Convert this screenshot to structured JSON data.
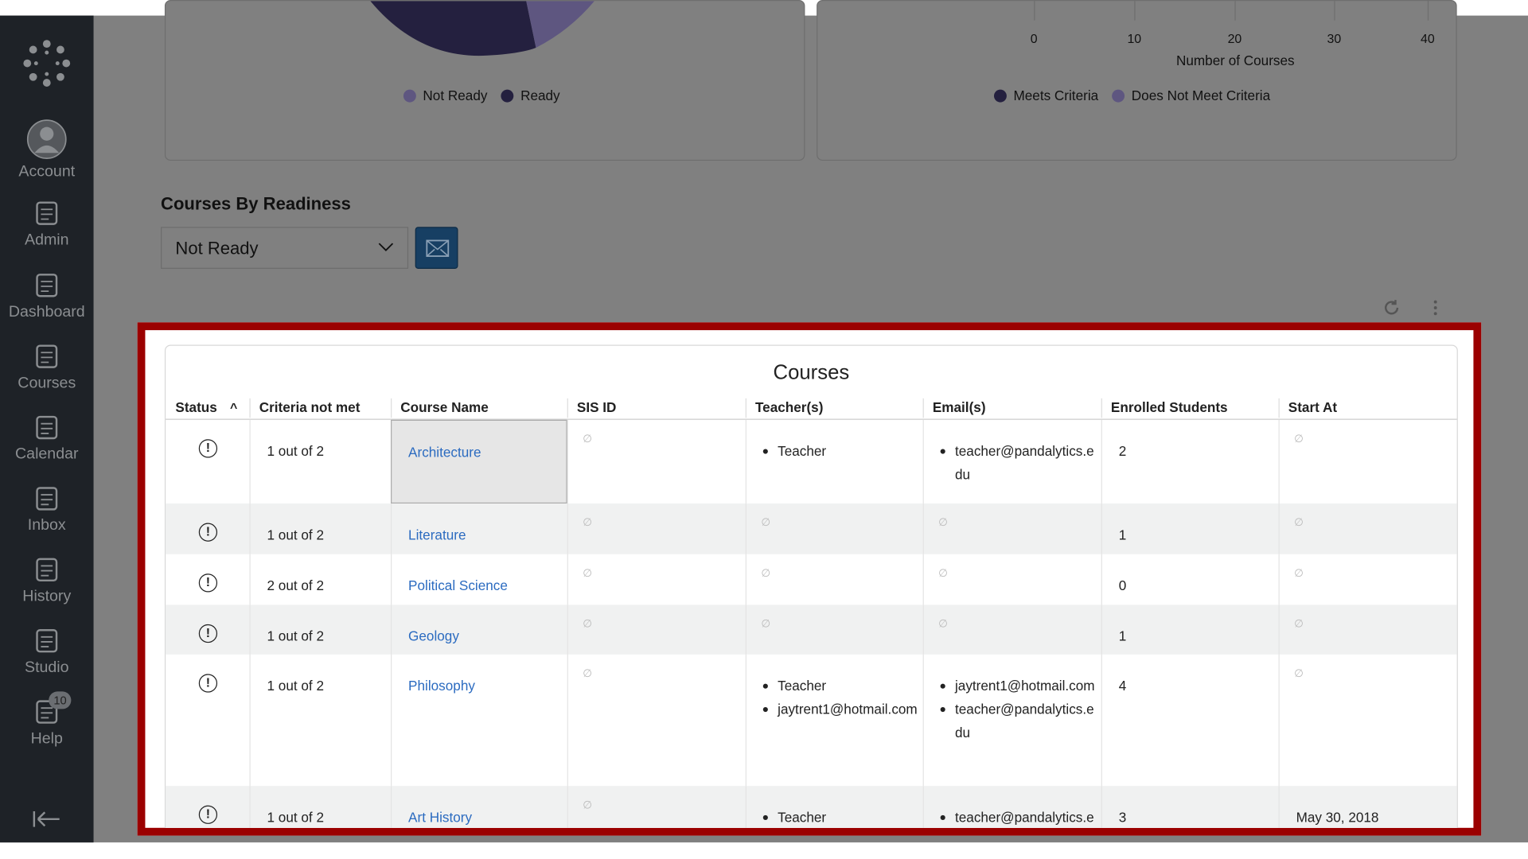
{
  "sidebar": {
    "items": [
      {
        "label": "Account",
        "icon": "account-icon"
      },
      {
        "label": "Admin",
        "icon": "admin-shield-icon"
      },
      {
        "label": "Dashboard",
        "icon": "dashboard-gauge-icon"
      },
      {
        "label": "Courses",
        "icon": "courses-book-icon"
      },
      {
        "label": "Calendar",
        "icon": "calendar-icon"
      },
      {
        "label": "Inbox",
        "icon": "inbox-icon"
      },
      {
        "label": "History",
        "icon": "clock-icon"
      },
      {
        "label": "Studio",
        "icon": "studio-icon"
      },
      {
        "label": "Help",
        "icon": "help-icon",
        "badge": "10"
      }
    ]
  },
  "pie_card": {
    "legend": [
      {
        "label": "Not Ready",
        "color": "#5e5680"
      },
      {
        "label": "Ready",
        "color": "#24203f"
      }
    ]
  },
  "bar_card": {
    "ticks": [
      "0",
      "10",
      "20",
      "30",
      "40"
    ],
    "xlabel": "Number of Courses",
    "legend": [
      {
        "label": "Meets Criteria",
        "color": "#24203f"
      },
      {
        "label": "Does Not Meet Criteria",
        "color": "#5e5680"
      }
    ]
  },
  "readiness": {
    "title": "Courses By Readiness",
    "selected": "Not Ready"
  },
  "table": {
    "title": "Courses",
    "columns": [
      "Status",
      "Criteria not met",
      "Course Name",
      "SIS ID",
      "Teacher(s)",
      "Email(s)",
      "Enrolled Students",
      "Start At"
    ],
    "null_symbol": "∅",
    "rows": [
      {
        "criteria": "1 out of 2",
        "course": "Architecture",
        "sis": null,
        "teachers": [
          "Teacher"
        ],
        "emails": [
          "teacher@pandalytics.edu"
        ],
        "enrolled": "2",
        "start": null
      },
      {
        "criteria": "1 out of 2",
        "course": "Literature",
        "sis": null,
        "teachers": null,
        "emails": null,
        "enrolled": "1",
        "start": null
      },
      {
        "criteria": "2 out of 2",
        "course": "Political Science",
        "sis": null,
        "teachers": null,
        "emails": null,
        "enrolled": "0",
        "start": null
      },
      {
        "criteria": "1 out of 2",
        "course": "Geology",
        "sis": null,
        "teachers": null,
        "emails": null,
        "enrolled": "1",
        "start": null
      },
      {
        "criteria": "1 out of 2",
        "course": "Philosophy",
        "sis": null,
        "teachers": [
          "Teacher",
          "jaytrent1@hotmail.com"
        ],
        "emails": [
          "jaytrent1@hotmail.com",
          "teacher@pandalytics.edu"
        ],
        "enrolled": "4",
        "start": null
      },
      {
        "criteria": "1 out of 2",
        "course": "Art History",
        "sis": null,
        "teachers": [
          "Teacher"
        ],
        "emails": [
          "teacher@pandalytics.edu"
        ],
        "enrolled": "3",
        "start": "May 30, 2018"
      }
    ]
  },
  "colors": {
    "highlight": "#9b0000",
    "link": "#2b6bc0",
    "sidebar": "#1e2227"
  }
}
